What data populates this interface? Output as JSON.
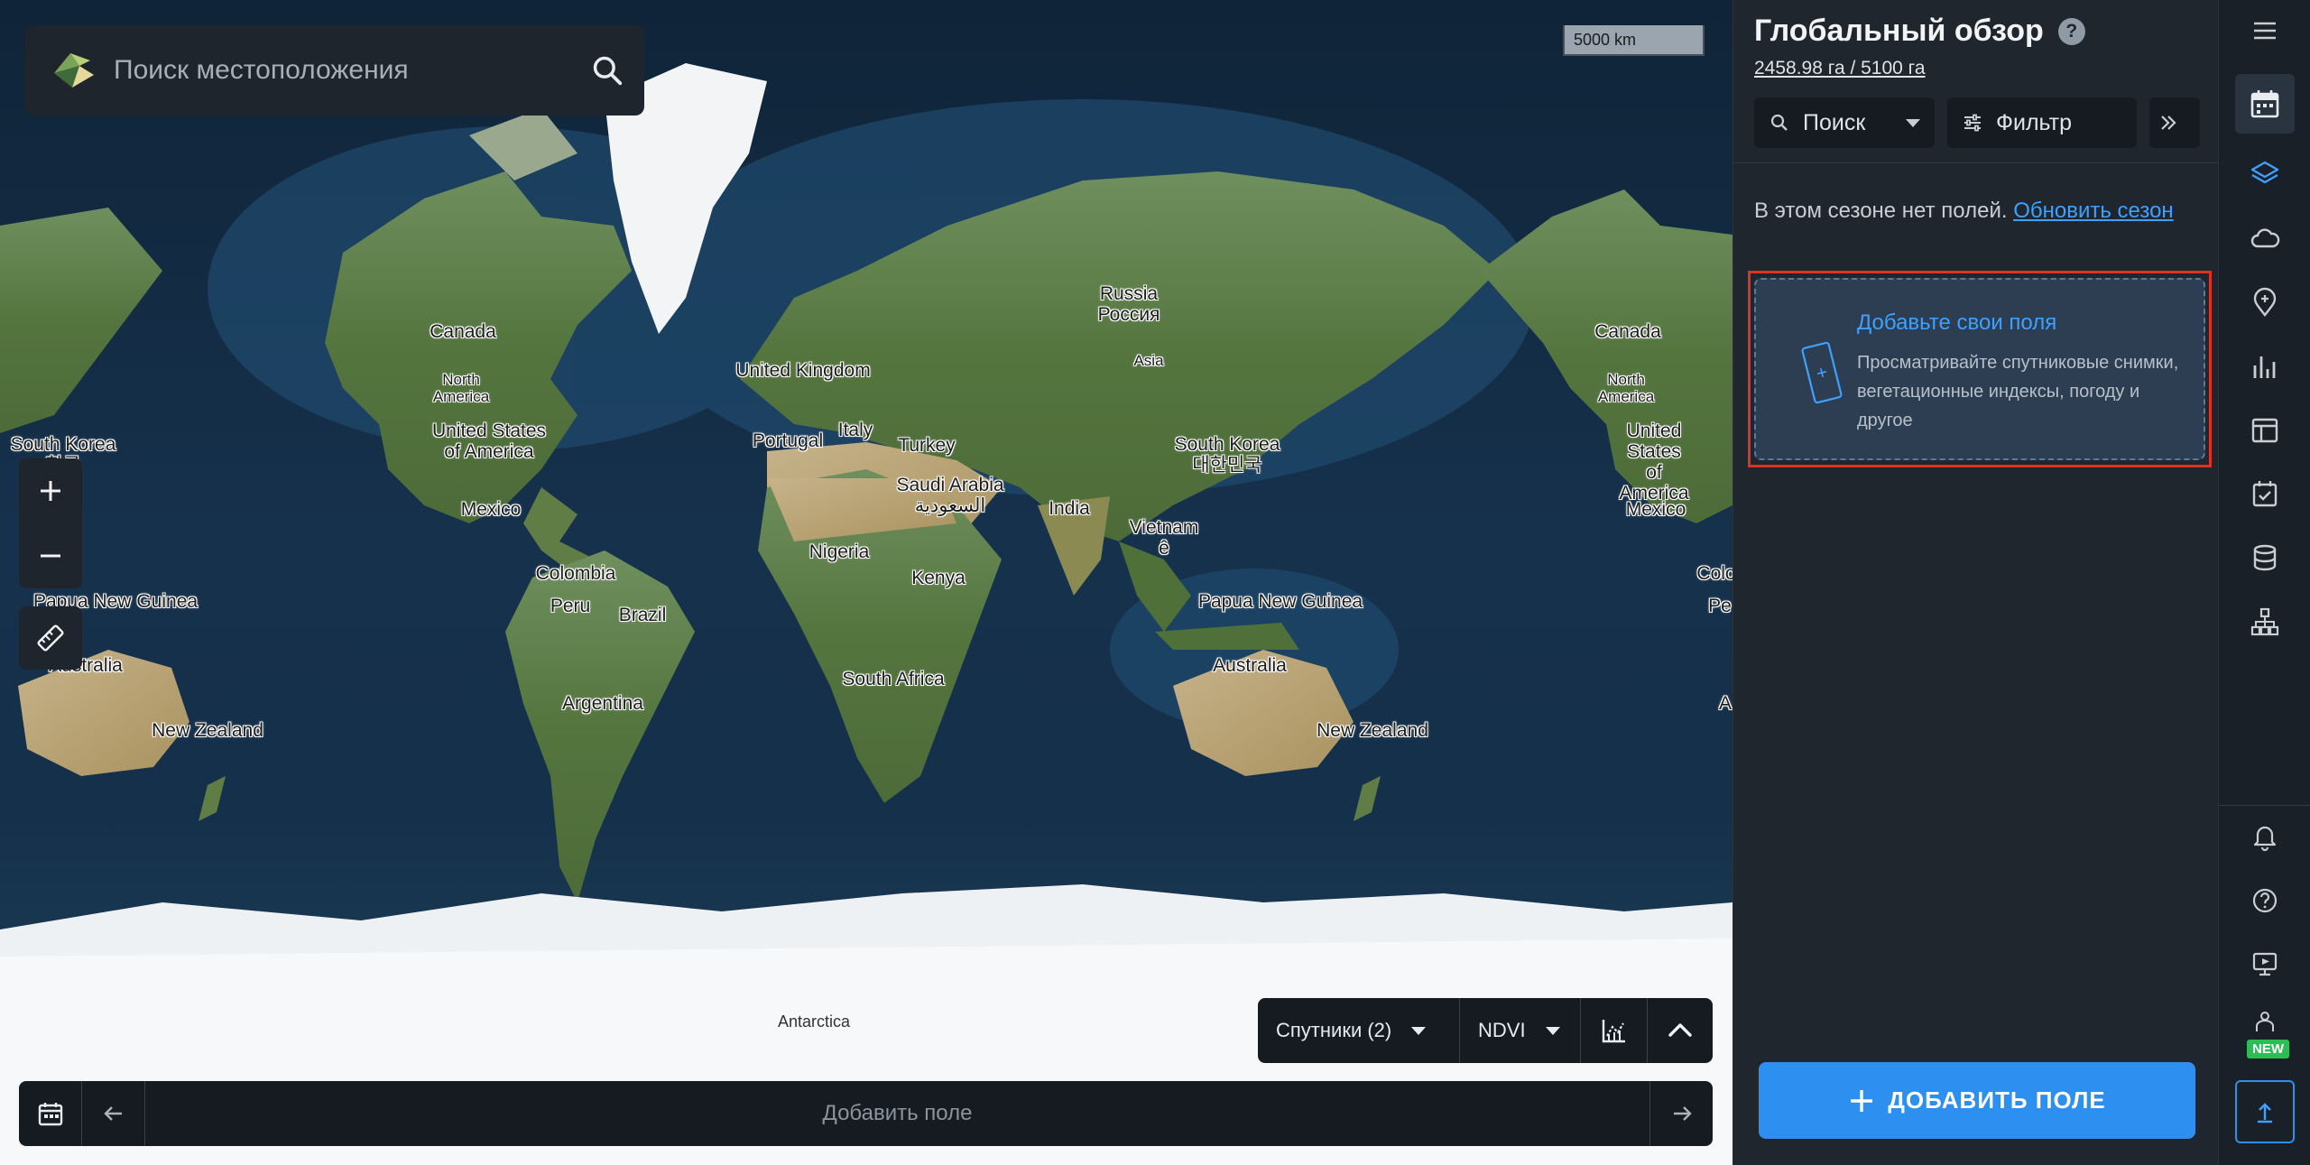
{
  "search": {
    "placeholder": "Поиск местоположения"
  },
  "map": {
    "scale": "5000 km",
    "labels": [
      {
        "id": "greenland-none",
        "text": ""
      },
      {
        "id": "canada-left",
        "text": "Canada"
      },
      {
        "id": "north-america-left",
        "text": "North\nAmerica"
      },
      {
        "id": "usa-left",
        "text": "United States\nof America"
      },
      {
        "id": "mexico-left",
        "text": "Mexico"
      },
      {
        "id": "south-korea-left",
        "text": "South Korea\n한국"
      },
      {
        "id": "colombia",
        "text": "Colombia"
      },
      {
        "id": "peru",
        "text": "Peru"
      },
      {
        "id": "brazil",
        "text": "Brazil"
      },
      {
        "id": "argentina",
        "text": "Argentina"
      },
      {
        "id": "png-left",
        "text": "Papua New Guinea"
      },
      {
        "id": "australia-left",
        "text": "Australia"
      },
      {
        "id": "nz-left",
        "text": "New Zealand"
      },
      {
        "id": "uk",
        "text": "United Kingdom"
      },
      {
        "id": "portugal",
        "text": "Portugal"
      },
      {
        "id": "italy",
        "text": "Italy"
      },
      {
        "id": "turkey",
        "text": "Turkey"
      },
      {
        "id": "saudi",
        "text": "Saudi Arabia\nالسعودية"
      },
      {
        "id": "nigeria",
        "text": "Nigeria"
      },
      {
        "id": "kenya",
        "text": "Kenya"
      },
      {
        "id": "south-africa",
        "text": "South Africa"
      },
      {
        "id": "russia",
        "text": "Russia\nРоссия"
      },
      {
        "id": "asia",
        "text": "Asia"
      },
      {
        "id": "india",
        "text": "India"
      },
      {
        "id": "south-korea",
        "text": "South Korea\n대한민국"
      },
      {
        "id": "vietnam",
        "text": "Vietnam\nê"
      },
      {
        "id": "png",
        "text": "Papua New Guinea"
      },
      {
        "id": "australia",
        "text": "Australia"
      },
      {
        "id": "nz",
        "text": "New Zealand"
      },
      {
        "id": "canada-right",
        "text": "Canada"
      },
      {
        "id": "north-america-right",
        "text": "North\nAmerica"
      },
      {
        "id": "usa-right",
        "text": "United States\nof America"
      },
      {
        "id": "mexico-right",
        "text": "Mexico"
      },
      {
        "id": "colombia-right",
        "text": "Colo"
      },
      {
        "id": "peru-right",
        "text": "Pe"
      },
      {
        "id": "argentina-right",
        "text": "A"
      },
      {
        "id": "antarctica",
        "text": "Antarctica"
      }
    ]
  },
  "layer_controls": {
    "satellites": "Спутники (2)",
    "index": "NDVI"
  },
  "bottom_bar": {
    "center_label": "Добавить поле"
  },
  "panel": {
    "title": "Глобальный обзор",
    "help": "?",
    "area": "2458.98 га / 5100 га",
    "search_label": "Поиск",
    "filter_label": "Фильтр",
    "no_fields_text": "В этом сезоне нет полей.",
    "update_season_link": "Обновить сезон",
    "add_card_title": "Добавьте свои поля",
    "add_card_text": "Просматривайте спутниковые снимки, вегетационные индексы, погоду и другое",
    "add_field_button": "ДОБАВИТЬ ПОЛЕ"
  },
  "rail": {
    "new_badge": "NEW",
    "items": [
      "menu-icon",
      "calendar-icon",
      "layers-icon",
      "cloud-icon",
      "location-pin-icon",
      "bar-chart-icon",
      "layout-icon",
      "task-calendar-icon",
      "database-icon",
      "org-structure-icon",
      "bell-icon",
      "help-icon",
      "monitor-icon",
      "robot-icon",
      "upload-icon"
    ]
  },
  "colors": {
    "accent": "#2d8fef",
    "link": "#3ea0ff",
    "highlight_outline": "#e0321e",
    "new_badge": "#2dbd56"
  }
}
